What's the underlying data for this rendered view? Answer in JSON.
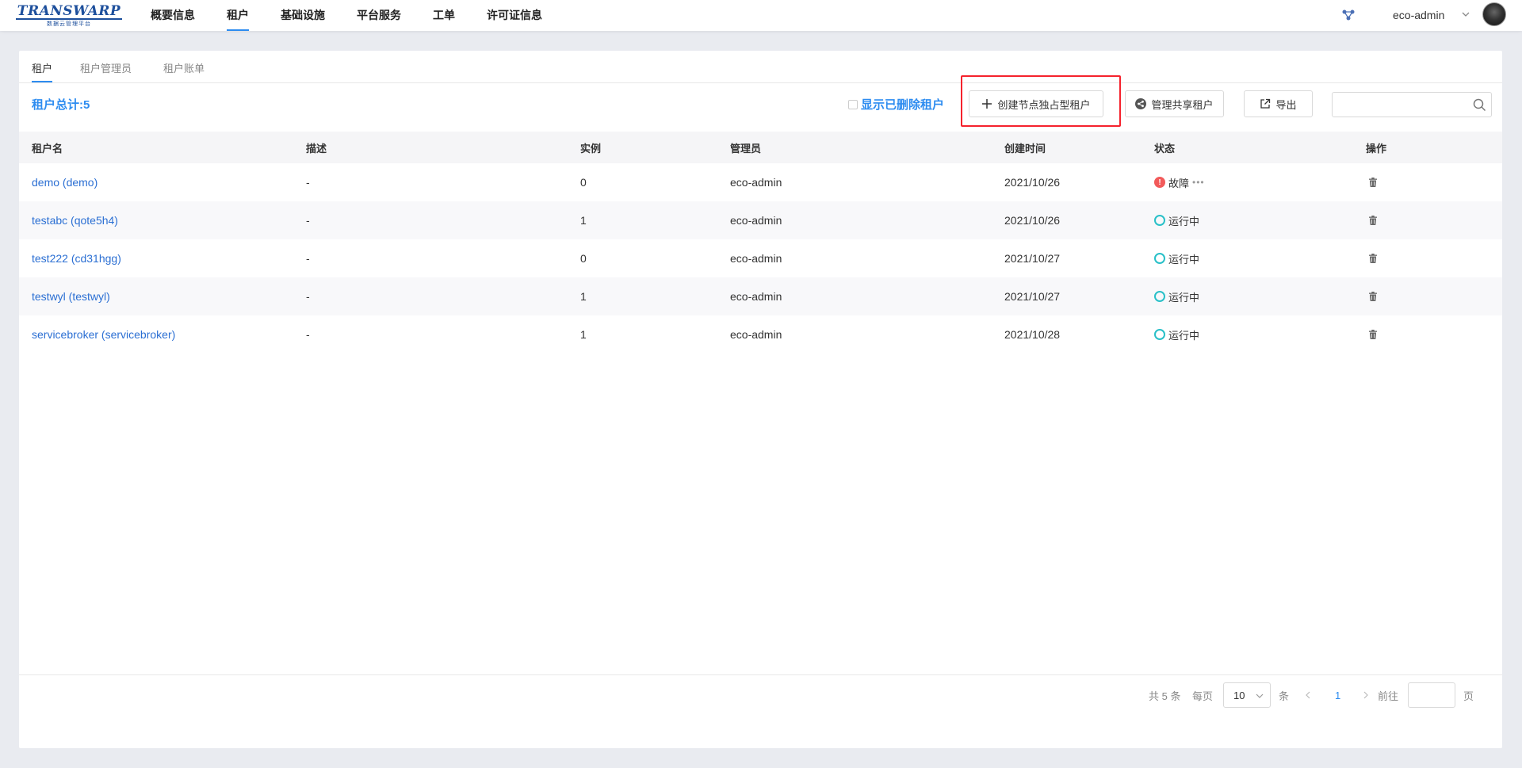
{
  "brand": {
    "name": "TRANSWARP",
    "subtitle": "数据云管理平台"
  },
  "nav": {
    "items": [
      {
        "label": "概要信息",
        "active": false
      },
      {
        "label": "租户",
        "active": true
      },
      {
        "label": "基础设施",
        "active": false
      },
      {
        "label": "平台服务",
        "active": false
      },
      {
        "label": "工单",
        "active": false
      },
      {
        "label": "许可证信息",
        "active": false
      }
    ]
  },
  "user": {
    "name": "eco-admin"
  },
  "tabs": [
    {
      "label": "租户",
      "active": true
    },
    {
      "label": "租户管理员",
      "active": false
    },
    {
      "label": "租户账单",
      "active": false
    }
  ],
  "toolbar": {
    "total_label": "租户总计:5",
    "show_deleted_label": "显示已删除租户",
    "create_label": "创建节点独占型租户",
    "manage_shared_label": "管理共享租户",
    "export_label": "导出",
    "search_placeholder": ""
  },
  "table": {
    "columns": [
      "租户名",
      "描述",
      "实例",
      "管理员",
      "创建时间",
      "状态",
      "操作"
    ],
    "rows": [
      {
        "name": "demo (demo)",
        "desc": "-",
        "instances": "0",
        "admin": "eco-admin",
        "created": "2021/10/26",
        "status": "故障",
        "status_type": "error"
      },
      {
        "name": "testabc (qote5h4)",
        "desc": "-",
        "instances": "1",
        "admin": "eco-admin",
        "created": "2021/10/26",
        "status": "运行中",
        "status_type": "running"
      },
      {
        "name": "test222 (cd31hgg)",
        "desc": "-",
        "instances": "0",
        "admin": "eco-admin",
        "created": "2021/10/27",
        "status": "运行中",
        "status_type": "running"
      },
      {
        "name": "testwyl (testwyl)",
        "desc": "-",
        "instances": "1",
        "admin": "eco-admin",
        "created": "2021/10/27",
        "status": "运行中",
        "status_type": "running"
      },
      {
        "name": "servicebroker (servicebroker)",
        "desc": "-",
        "instances": "1",
        "admin": "eco-admin",
        "created": "2021/10/28",
        "status": "运行中",
        "status_type": "running"
      }
    ]
  },
  "pagination": {
    "total_label": "共 5 条",
    "per_page_label": "每页",
    "page_size": "10",
    "unit_label": "条",
    "current_page": "1",
    "goto_label": "前往",
    "page_label": "页"
  },
  "colors": {
    "accent": "#2d8cf0",
    "link": "#2b6fd3",
    "running": "#29c0c8",
    "error": "#f25a5a",
    "highlight": "#f5222d"
  }
}
